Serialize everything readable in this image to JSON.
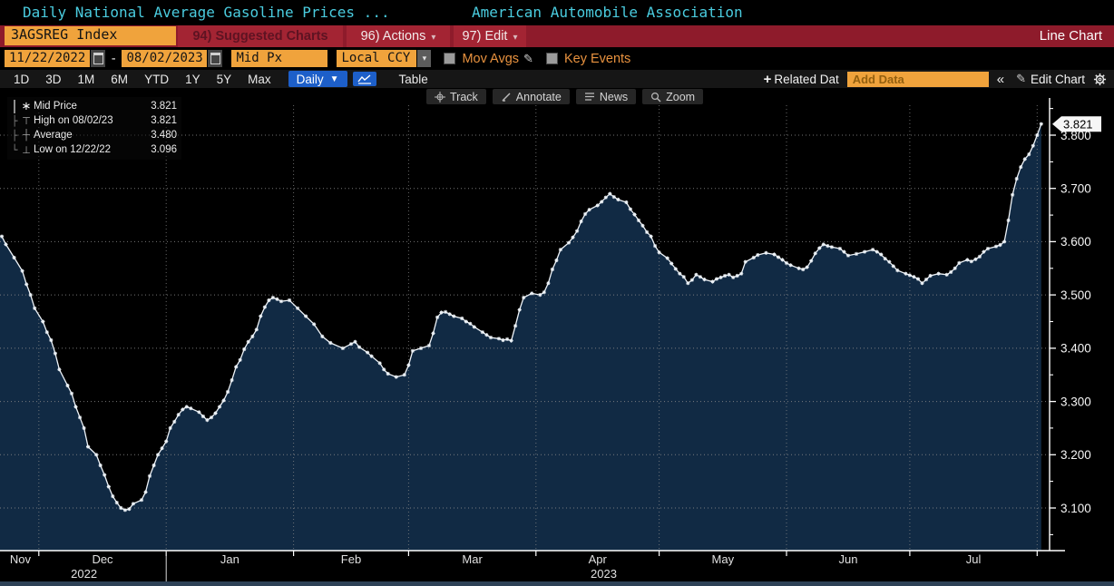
{
  "header": {
    "title_left": "Daily National Average Gasoline Prices ...",
    "title_right": "American Automobile Association"
  },
  "command_bar": {
    "security": "3AGSREG Index",
    "suggested_charts": "94) Suggested Charts",
    "actions": "96) Actions",
    "edit": "97) Edit",
    "view_label": "Line Chart"
  },
  "filters": {
    "date_from": "11/22/2022",
    "date_separator": "-",
    "date_to": "08/02/2023",
    "price_field": "Mid Px",
    "currency": "Local CCY",
    "mov_avgs_label": "Mov Avgs",
    "key_events_label": "Key Events"
  },
  "range_bar": {
    "periods": [
      "1D",
      "3D",
      "1M",
      "6M",
      "YTD",
      "1Y",
      "5Y",
      "Max"
    ],
    "frequency": "Daily",
    "table_label": "Table",
    "related_label": "Related Dat",
    "plus_sign": "+",
    "add_data_placeholder": "Add Data",
    "collapse_chevrons": "«",
    "edit_chart_label": "Edit Chart"
  },
  "chart_toolbar": {
    "track": "Track",
    "annotate": "Annotate",
    "news": "News",
    "zoom": "Zoom"
  },
  "legend": {
    "rows": [
      {
        "icon": "star-marker",
        "branch": "",
        "label": "Mid Price",
        "value": "3.821"
      },
      {
        "icon": "high-whisker",
        "branch": "├",
        "label": "High on 08/02/23",
        "value": "3.821"
      },
      {
        "icon": "avg-marker",
        "branch": "├",
        "label": "Average",
        "value": "3.480"
      },
      {
        "icon": "low-whisker",
        "branch": "└",
        "label": "Low on 12/22/22",
        "value": "3.096"
      }
    ]
  },
  "chart_data": {
    "type": "area",
    "title": "Daily National Average Gasoline Prices (Mid Price)",
    "source": "American Automobile Association",
    "x_start_date": "11/22/2022",
    "x_end_date": "08/02/2023",
    "ylim": [
      3.05,
      3.85
    ],
    "yticks": [
      3.1,
      3.2,
      3.3,
      3.4,
      3.5,
      3.6,
      3.7,
      3.8
    ],
    "yticks_minor": [
      3.05,
      3.15,
      3.25,
      3.35,
      3.45,
      3.55,
      3.65,
      3.75,
      3.85
    ],
    "grid": true,
    "last_price": 3.821,
    "stats": {
      "high": 3.821,
      "high_date": "08/02/23",
      "average": 3.48,
      "low": 3.096,
      "low_date": "12/22/22"
    },
    "month_boundaries_days": [
      9,
      40,
      71,
      99,
      130,
      160,
      191,
      221,
      252
    ],
    "year_divider_day": 40,
    "month_labels": [
      {
        "label": "Nov",
        "center_day": 4.5
      },
      {
        "label": "Dec",
        "center_day": 24.5
      },
      {
        "label": "Jan",
        "center_day": 55.5
      },
      {
        "label": "Feb",
        "center_day": 85
      },
      {
        "label": "Mar",
        "center_day": 114.5
      },
      {
        "label": "Apr",
        "center_day": 145
      },
      {
        "label": "May",
        "center_day": 175.5
      },
      {
        "label": "Jun",
        "center_day": 206
      },
      {
        "label": "Jul",
        "center_day": 236.5
      }
    ],
    "year_labels": [
      {
        "label": "2022",
        "center_day": 20
      },
      {
        "label": "2023",
        "center_day": 146.5
      }
    ],
    "colors": {
      "line": "#eef3f8",
      "fill": "#112a44",
      "grid": "#8a8a8a",
      "axis": "#ffffff",
      "badge_bg": "#f6f6f6",
      "badge_text": "#000000"
    },
    "points": [
      [
        0,
        3.61
      ],
      [
        1,
        3.595
      ],
      [
        3,
        3.57
      ],
      [
        5,
        3.545
      ],
      [
        6,
        3.52
      ],
      [
        7,
        3.5
      ],
      [
        8,
        3.475
      ],
      [
        10,
        3.45
      ],
      [
        11,
        3.43
      ],
      [
        12,
        3.415
      ],
      [
        13,
        3.39
      ],
      [
        14,
        3.36
      ],
      [
        16,
        3.33
      ],
      [
        17,
        3.315
      ],
      [
        18,
        3.29
      ],
      [
        19,
        3.27
      ],
      [
        20,
        3.25
      ],
      [
        21,
        3.215
      ],
      [
        23,
        3.2
      ],
      [
        24,
        3.18
      ],
      [
        25,
        3.162
      ],
      [
        26,
        3.14
      ],
      [
        27,
        3.122
      ],
      [
        28,
        3.11
      ],
      [
        29,
        3.1
      ],
      [
        30,
        3.096
      ],
      [
        31,
        3.098
      ],
      [
        32,
        3.108
      ],
      [
        34,
        3.115
      ],
      [
        35,
        3.13
      ],
      [
        36,
        3.16
      ],
      [
        37,
        3.18
      ],
      [
        38,
        3.2
      ],
      [
        39,
        3.212
      ],
      [
        40,
        3.225
      ],
      [
        41,
        3.25
      ],
      [
        42,
        3.262
      ],
      [
        43,
        3.275
      ],
      [
        44,
        3.285
      ],
      [
        45,
        3.29
      ],
      [
        46,
        3.287
      ],
      [
        48,
        3.28
      ],
      [
        49,
        3.272
      ],
      [
        50,
        3.265
      ],
      [
        51,
        3.27
      ],
      [
        52,
        3.278
      ],
      [
        53,
        3.29
      ],
      [
        54,
        3.302
      ],
      [
        55,
        3.318
      ],
      [
        56,
        3.34
      ],
      [
        57,
        3.365
      ],
      [
        58,
        3.378
      ],
      [
        59,
        3.398
      ],
      [
        60,
        3.412
      ],
      [
        61,
        3.422
      ],
      [
        62,
        3.435
      ],
      [
        63,
        3.46
      ],
      [
        64,
        3.477
      ],
      [
        65,
        3.49
      ],
      [
        66,
        3.495
      ],
      [
        67,
        3.492
      ],
      [
        68,
        3.488
      ],
      [
        70,
        3.49
      ],
      [
        72,
        3.475
      ],
      [
        74,
        3.46
      ],
      [
        76,
        3.445
      ],
      [
        78,
        3.422
      ],
      [
        80,
        3.41
      ],
      [
        83,
        3.4
      ],
      [
        85,
        3.408
      ],
      [
        86,
        3.412
      ],
      [
        87,
        3.402
      ],
      [
        89,
        3.392
      ],
      [
        90,
        3.385
      ],
      [
        92,
        3.372
      ],
      [
        93,
        3.36
      ],
      [
        94,
        3.352
      ],
      [
        96,
        3.346
      ],
      [
        98,
        3.35
      ],
      [
        99,
        3.368
      ],
      [
        100,
        3.395
      ],
      [
        102,
        3.4
      ],
      [
        104,
        3.405
      ],
      [
        105,
        3.428
      ],
      [
        106,
        3.458
      ],
      [
        107,
        3.467
      ],
      [
        108,
        3.468
      ],
      [
        109,
        3.464
      ],
      [
        110,
        3.46
      ],
      [
        112,
        3.456
      ],
      [
        113,
        3.45
      ],
      [
        114,
        3.446
      ],
      [
        115,
        3.44
      ],
      [
        117,
        3.43
      ],
      [
        118,
        3.425
      ],
      [
        119,
        3.42
      ],
      [
        121,
        3.418
      ],
      [
        122,
        3.415
      ],
      [
        123,
        3.417
      ],
      [
        124,
        3.414
      ],
      [
        125,
        3.442
      ],
      [
        126,
        3.472
      ],
      [
        127,
        3.495
      ],
      [
        129,
        3.503
      ],
      [
        131,
        3.5
      ],
      [
        132,
        3.505
      ],
      [
        133,
        3.522
      ],
      [
        134,
        3.548
      ],
      [
        135,
        3.565
      ],
      [
        136,
        3.585
      ],
      [
        138,
        3.598
      ],
      [
        139,
        3.608
      ],
      [
        140,
        3.62
      ],
      [
        141,
        3.638
      ],
      [
        142,
        3.652
      ],
      [
        143,
        3.66
      ],
      [
        145,
        3.668
      ],
      [
        146,
        3.675
      ],
      [
        147,
        3.683
      ],
      [
        148,
        3.69
      ],
      [
        149,
        3.684
      ],
      [
        150,
        3.679
      ],
      [
        152,
        3.674
      ],
      [
        153,
        3.661
      ],
      [
        154,
        3.651
      ],
      [
        155,
        3.64
      ],
      [
        156,
        3.63
      ],
      [
        157,
        3.618
      ],
      [
        158,
        3.61
      ],
      [
        159,
        3.592
      ],
      [
        160,
        3.58
      ],
      [
        162,
        3.569
      ],
      [
        163,
        3.559
      ],
      [
        164,
        3.549
      ],
      [
        165,
        3.54
      ],
      [
        166,
        3.534
      ],
      [
        167,
        3.522
      ],
      [
        168,
        3.528
      ],
      [
        169,
        3.538
      ],
      [
        170,
        3.534
      ],
      [
        171,
        3.529
      ],
      [
        173,
        3.525
      ],
      [
        174,
        3.53
      ],
      [
        175,
        3.533
      ],
      [
        176,
        3.536
      ],
      [
        177,
        3.538
      ],
      [
        178,
        3.533
      ],
      [
        179,
        3.536
      ],
      [
        180,
        3.54
      ],
      [
        181,
        3.562
      ],
      [
        183,
        3.57
      ],
      [
        184,
        3.575
      ],
      [
        186,
        3.579
      ],
      [
        188,
        3.576
      ],
      [
        189,
        3.571
      ],
      [
        190,
        3.566
      ],
      [
        191,
        3.56
      ],
      [
        192,
        3.556
      ],
      [
        194,
        3.55
      ],
      [
        195,
        3.548
      ],
      [
        196,
        3.552
      ],
      [
        197,
        3.564
      ],
      [
        198,
        3.578
      ],
      [
        199,
        3.588
      ],
      [
        200,
        3.595
      ],
      [
        201,
        3.592
      ],
      [
        202,
        3.59
      ],
      [
        204,
        3.587
      ],
      [
        205,
        3.581
      ],
      [
        206,
        3.574
      ],
      [
        208,
        3.577
      ],
      [
        210,
        3.581
      ],
      [
        212,
        3.585
      ],
      [
        213,
        3.581
      ],
      [
        214,
        3.576
      ],
      [
        215,
        3.568
      ],
      [
        216,
        3.562
      ],
      [
        217,
        3.554
      ],
      [
        218,
        3.546
      ],
      [
        220,
        3.54
      ],
      [
        221,
        3.537
      ],
      [
        222,
        3.534
      ],
      [
        223,
        3.53
      ],
      [
        224,
        3.522
      ],
      [
        225,
        3.529
      ],
      [
        226,
        3.536
      ],
      [
        228,
        3.54
      ],
      [
        230,
        3.538
      ],
      [
        231,
        3.543
      ],
      [
        232,
        3.55
      ],
      [
        233,
        3.56
      ],
      [
        235,
        3.566
      ],
      [
        236,
        3.563
      ],
      [
        237,
        3.567
      ],
      [
        238,
        3.572
      ],
      [
        239,
        3.581
      ],
      [
        240,
        3.587
      ],
      [
        242,
        3.591
      ],
      [
        243,
        3.594
      ],
      [
        244,
        3.6
      ],
      [
        245,
        3.64
      ],
      [
        246,
        3.688
      ],
      [
        247,
        3.718
      ],
      [
        248,
        3.74
      ],
      [
        249,
        3.755
      ],
      [
        250,
        3.764
      ],
      [
        251,
        3.78
      ],
      [
        252,
        3.8
      ],
      [
        253,
        3.821
      ]
    ]
  }
}
